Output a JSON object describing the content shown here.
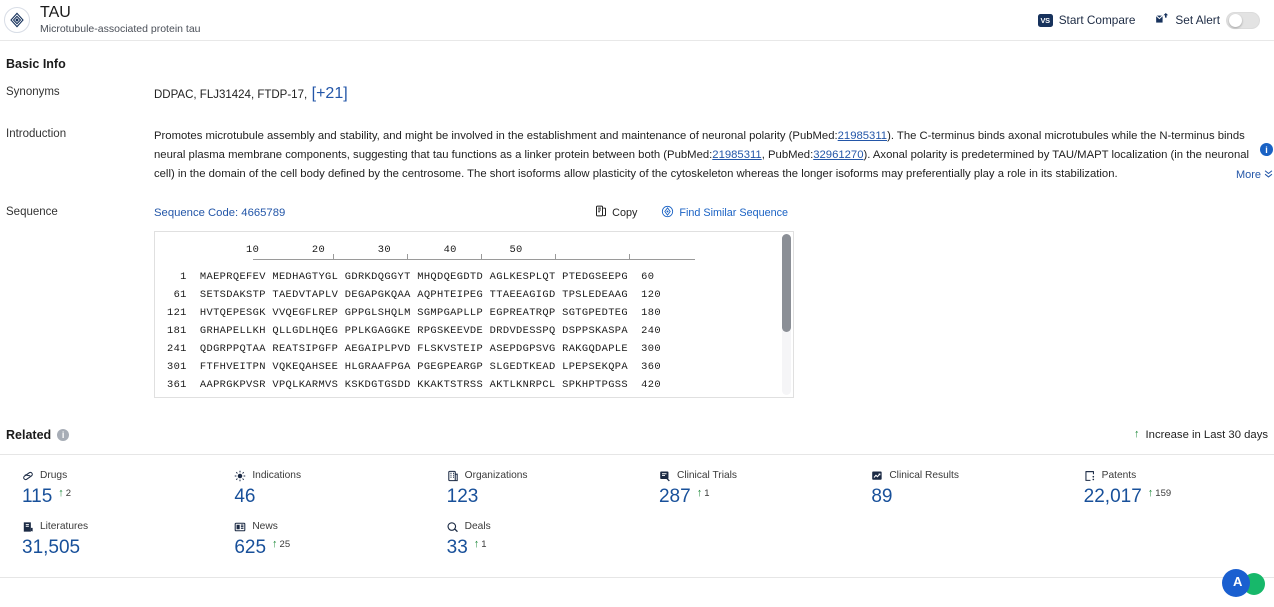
{
  "header": {
    "gene_icon": "target-icon",
    "title": "TAU",
    "subtitle": "Microtubule-associated protein tau",
    "start_compare_label": "Start Compare",
    "start_compare_icon": "vs-icon",
    "vs_text": "VS",
    "set_alert_label": "Set Alert",
    "set_alert_icon": "bell-alert-icon",
    "alert_toggle_state": "off"
  },
  "basic_info": {
    "title": "Basic Info",
    "synonyms": {
      "label": "Synonyms",
      "values": "DDPAC,  FLJ31424,  FTDP-17,",
      "more_count": "[+21]"
    },
    "introduction": {
      "label": "Introduction",
      "part1": "Promotes microtubule assembly and stability, and might be involved in the establishment and maintenance of neuronal polarity (PubMed:",
      "link1": "21985311",
      "part2": "). The C-terminus binds axonal microtubules while the N-terminus binds neural plasma membrane components, suggesting that tau functions as a linker protein between both (PubMed:",
      "link2": "21985311",
      "part3": ", PubMed:",
      "link3": "32961270",
      "part4": "). Axonal polarity is predetermined by TAU/MAPT localization (in the neuronal cell) in the domain of the cell body defined by the centrosome. The short isoforms allow plasticity of the cytoskeleton whereas the longer isoforms may preferentially play a role in its stabilization.",
      "info_badge": "i",
      "more_label": "More",
      "more_icon": "chevron-double-down-icon"
    },
    "sequence": {
      "label": "Sequence",
      "code_label": "Sequence Code: 4665789",
      "copy_label": "Copy",
      "copy_icon": "copy-icon",
      "find_similar_label": "Find Similar Sequence",
      "find_similar_icon": "find-similar-icon",
      "ruler_numbers": "            10        20        30        40        50",
      "ruler_ticks": [
        10,
        20,
        30,
        40,
        50
      ],
      "rows": [
        {
          "start": "1",
          "blocks": "MAEPRQEFEV MEDHAGTYGL GDRKDQGGYT MHQDQEGDTD AGLKESPLQT PTEDGSEEPG",
          "end": "60"
        },
        {
          "start": "61",
          "blocks": "SETSDAKSTP TAEDVTAPLV DEGAPGKQAA AQPHTEIPEG TTAEEAGIGD TPSLEDEAAG",
          "end": "120"
        },
        {
          "start": "121",
          "blocks": "HVTQEPESGK VVQEGFLREP GPPGLSHQLM SGMPGAPLLP EGPREATRQP SGTGPEDTEG",
          "end": "180"
        },
        {
          "start": "181",
          "blocks": "GRHAPELLKH QLLGDLHQEG PPLKGAGGKE RPGSKEEVDE DRDVDESSPQ DSPPSKASPA",
          "end": "240"
        },
        {
          "start": "241",
          "blocks": "QDGRPPQTAA REATSIPGFP AEGAIPLPVD FLSKVSTEIP ASEPDGPSVG RAKGQDAPLE",
          "end": "300"
        },
        {
          "start": "301",
          "blocks": "FTFHVEITPN VQKEQAHSEE HLGRAAFPGA PGEGPEARGP SLGEDTKEAD LPEPSEKQPA",
          "end": "360"
        },
        {
          "start": "361",
          "blocks": "AAPRGKPVSR VPQLKARMVS KSKDGTGSDD KKAKTSTRSS AKTLKNRPCL SPKHPTPGSS",
          "end": "420"
        }
      ]
    }
  },
  "related": {
    "title": "Related",
    "info_icon": "info-icon",
    "legend_icon": "arrow-up-icon",
    "legend_label": "Increase in Last 30 days",
    "cards": [
      {
        "icon": "pill-icon",
        "label": "Drugs",
        "value": "115",
        "delta": "2"
      },
      {
        "icon": "virus-icon",
        "label": "Indications",
        "value": "46",
        "delta": ""
      },
      {
        "icon": "building-icon",
        "label": "Organizations",
        "value": "123",
        "delta": ""
      },
      {
        "icon": "clinical-trial-icon",
        "label": "Clinical Trials",
        "value": "287",
        "delta": "1"
      },
      {
        "icon": "clinical-result-icon",
        "label": "Clinical Results",
        "value": "89",
        "delta": ""
      },
      {
        "icon": "patent-icon",
        "label": "Patents",
        "value": "22,017",
        "delta": "159"
      },
      {
        "icon": "book-icon",
        "label": "Literatures",
        "value": "31,505",
        "delta": ""
      },
      {
        "icon": "news-icon",
        "label": "News",
        "value": "625",
        "delta": "25"
      },
      {
        "icon": "deal-icon",
        "label": "Deals",
        "value": "33",
        "delta": "1"
      }
    ]
  },
  "colors": {
    "accent_blue": "#18509a",
    "link_blue": "#2356a8",
    "increase_green": "#1f8a3b",
    "brand_navy": "#17325c"
  },
  "floating_widget": {
    "icon": "chat-assistant-icon"
  }
}
